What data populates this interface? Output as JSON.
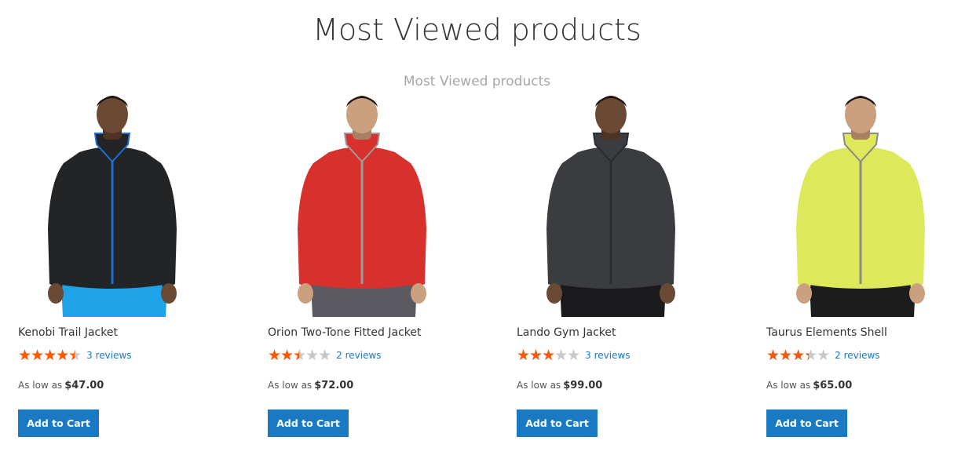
{
  "page": {
    "title": "Most Viewed products",
    "block_title": "Most Viewed products"
  },
  "colors": {
    "accent": "#1979c3",
    "star_fill": "#ff5501",
    "star_empty": "#c7c7c7"
  },
  "products": [
    {
      "name": "Kenobi Trail Jacket",
      "rating_percent": 90,
      "reviews": "3 reviews",
      "price_label": "As low as",
      "price": "$47.00",
      "button": "Add to Cart",
      "jacket_color": "#222426",
      "accent": "#1f6fd1",
      "pants": "#1fa3e8",
      "image_icon": "model-black-jacket"
    },
    {
      "name": "Orion Two-Tone Fitted Jacket",
      "rating_percent": 50,
      "reviews": "2 reviews",
      "price_label": "As low as",
      "price": "$72.00",
      "button": "Add to Cart",
      "jacket_color": "#d8302d",
      "accent": "#9b9b9b",
      "pants": "#5b5a60",
      "image_icon": "model-red-jacket"
    },
    {
      "name": "Lando Gym Jacket",
      "rating_percent": 60,
      "reviews": "3 reviews",
      "price_label": "As low as",
      "price": "$99.00",
      "button": "Add to Cart",
      "jacket_color": "#3b3c40",
      "accent": "#2a2b2e",
      "pants": "#1a1a1c",
      "image_icon": "model-gray-jacket"
    },
    {
      "name": "Taurus Elements Shell",
      "rating_percent": 67,
      "reviews": "2 reviews",
      "price_label": "As low as",
      "price": "$65.00",
      "button": "Add to Cart",
      "jacket_color": "#dde95a",
      "accent": "#8a8a8a",
      "pants": "#1c1c1c",
      "image_icon": "model-yellow-jacket"
    }
  ]
}
